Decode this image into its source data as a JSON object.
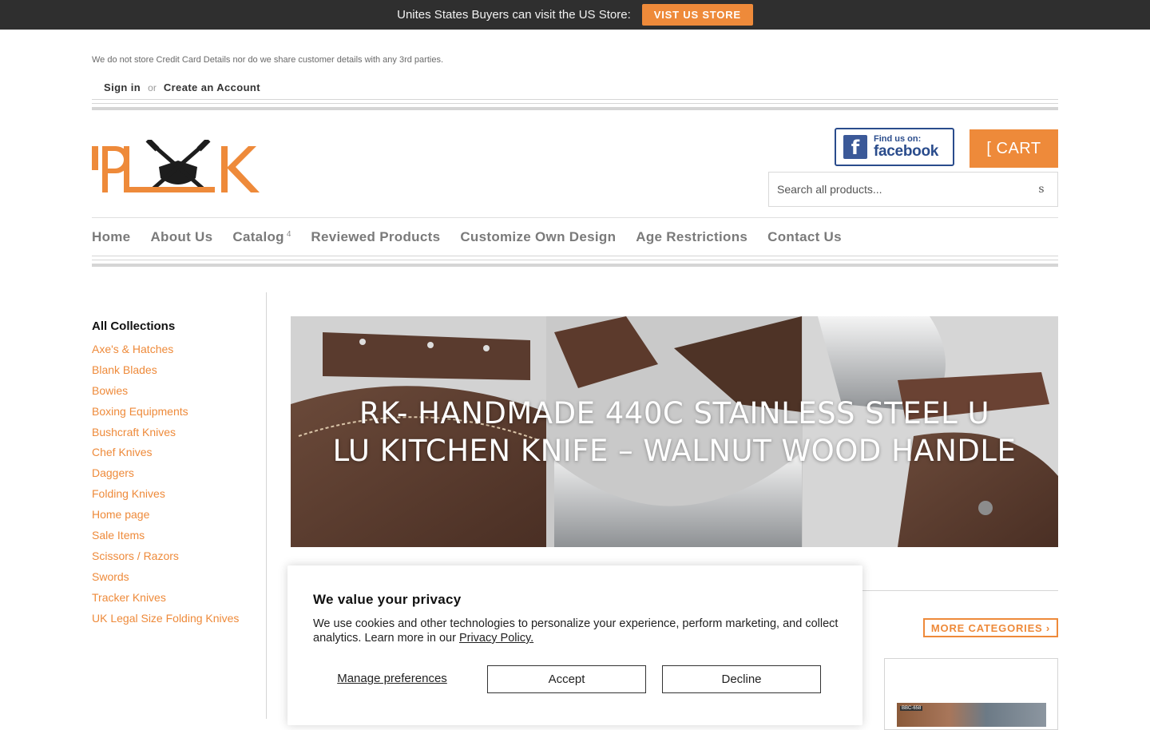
{
  "topbar": {
    "message": "Unites States Buyers can visit the US Store:",
    "button_label": "VIST US STORE"
  },
  "header": {
    "notice": "We do not store Credit Card Details nor do we share customer details with any 3rd parties.",
    "sign_in": "Sign in",
    "or": "or",
    "create_account": "Create an Account",
    "facebook_badge": {
      "find": "Find us on:",
      "name": "facebook",
      "icon": "facebook-icon"
    },
    "cart_label": "[ CART",
    "search": {
      "placeholder": "Search all products...",
      "icon_glyph": "s"
    }
  },
  "nav": {
    "items": [
      {
        "label": "Home"
      },
      {
        "label": "About Us"
      },
      {
        "label": "Catalog",
        "badge": "4"
      },
      {
        "label": "Reviewed Products"
      },
      {
        "label": "Customize Own Design"
      },
      {
        "label": "Age Restrictions"
      },
      {
        "label": "Contact Us"
      }
    ]
  },
  "sidebar": {
    "title": "All Collections",
    "items": [
      "Axe's & Hatches",
      "Blank Blades",
      "Bowies",
      "Boxing Equipments",
      "Bushcraft Knives",
      "Chef Knives",
      "Daggers",
      "Folding Knives",
      "Home page",
      "Sale Items",
      "Scissors / Razors",
      "Swords",
      "Tracker Knives",
      "UK Legal Size Folding Knives"
    ]
  },
  "banner": {
    "line1": "RK- HANDMADE 440C STAINLESS STEEL U",
    "line2": "LU KITCHEN KNIFE – WALNUT WOOD HANDLE"
  },
  "content": {
    "more_categories": "MORE CATEGORIES ›",
    "product_tag": "BBC-658"
  },
  "cookie": {
    "title": "We value your privacy",
    "body": "We use cookies and other technologies to personalize your experience, perform marketing, and collect analytics. Learn more in our",
    "link": "Privacy Policy.",
    "manage": "Manage preferences",
    "accept": "Accept",
    "decline": "Decline"
  },
  "colors": {
    "accent": "#ee8a3a",
    "topbar": "#2f2f2f",
    "facebook": "#3b5998"
  }
}
